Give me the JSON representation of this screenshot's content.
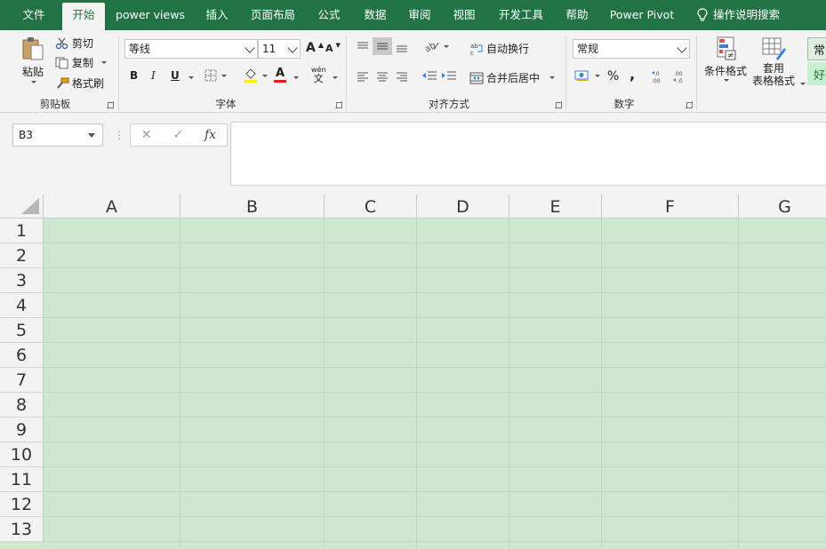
{
  "tabs": [
    "文件",
    "开始",
    "power views",
    "插入",
    "页面布局",
    "公式",
    "数据",
    "审阅",
    "视图",
    "开发工具",
    "帮助",
    "Power Pivot"
  ],
  "active_tab": "开始",
  "tell_me": "操作说明搜索",
  "clipboard": {
    "paste": "粘贴",
    "cut": "剪切",
    "copy": "复制",
    "format_painter": "格式刷",
    "label": "剪贴板"
  },
  "font": {
    "name": "等线",
    "size": "11",
    "bold": "B",
    "italic": "I",
    "underline": "U",
    "grow": "A",
    "shrink": "A",
    "font_color": "A",
    "wen": "wén",
    "wen_char": "文",
    "label": "字体"
  },
  "alignment": {
    "wrap_text": "自动换行",
    "merge_center": "合并后居中",
    "label": "对齐方式"
  },
  "number": {
    "format": "常规",
    "percent": "%",
    "comma": ",",
    "label": "数字"
  },
  "styles": {
    "conditional": "条件格式",
    "table_line1": "套用",
    "table_line2": "表格格式",
    "style_normal": "常",
    "style_good": "好"
  },
  "formula_bar": {
    "name_box": "B3",
    "cancel": "✕",
    "enter": "✓",
    "fx": "fx",
    "content": ""
  },
  "sheet": {
    "columns": [
      "A",
      "B",
      "C",
      "D",
      "E",
      "F",
      "G"
    ],
    "rows": [
      "1",
      "2",
      "3",
      "4",
      "5",
      "6",
      "7",
      "8",
      "9",
      "10",
      "11",
      "12",
      "13"
    ]
  },
  "colors": {
    "brand": "#217346",
    "cell_fill": "#cde8cf",
    "font_color_bar": "#e02020",
    "highlight_bar": "#ffef00"
  }
}
